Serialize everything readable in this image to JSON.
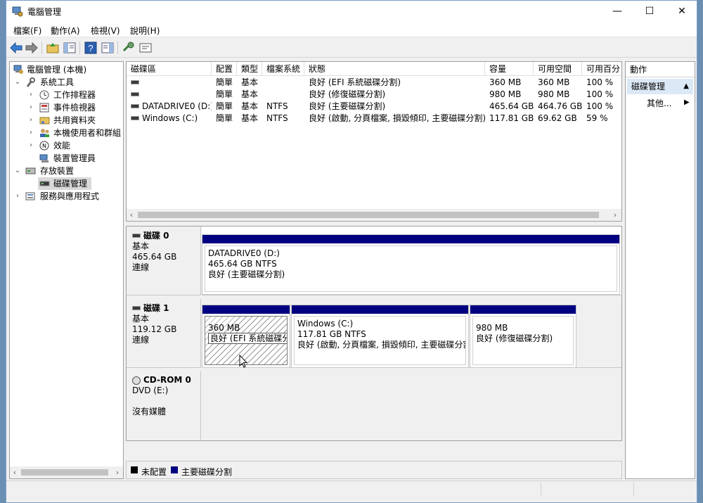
{
  "window": {
    "title": "電腦管理"
  },
  "menu": [
    "檔案(F)",
    "動作(A)",
    "檢視(V)",
    "說明(H)"
  ],
  "tree": {
    "root": "電腦管理 (本機)",
    "system_tools": "系統工具",
    "task_scheduler": "工作排程器",
    "event_viewer": "事件檢視器",
    "shared_folders": "共用資料夾",
    "local_users": "本機使用者和群組",
    "performance": "效能",
    "device_manager": "裝置管理員",
    "storage": "存放裝置",
    "disk_management": "磁碟管理",
    "services_apps": "服務與應用程式"
  },
  "volume_table": {
    "headers": [
      "磁碟區",
      "配置",
      "類型",
      "檔案系統",
      "狀態",
      "容量",
      "可用空間",
      "可用百分"
    ],
    "rows": [
      [
        "",
        "簡單",
        "基本",
        "",
        "良好 (EFI 系統磁碟分割)",
        "360 MB",
        "360 MB",
        "100 %"
      ],
      [
        "",
        "簡單",
        "基本",
        "",
        "良好 (修復磁碟分割)",
        "980 MB",
        "980 MB",
        "100 %"
      ],
      [
        "DATADRIVE0 (D:)",
        "簡單",
        "基本",
        "NTFS",
        "良好 (主要磁碟分割)",
        "465.64 GB",
        "464.76 GB",
        "100 %"
      ],
      [
        "Windows (C:)",
        "簡單",
        "基本",
        "NTFS",
        "良好 (啟動, 分頁檔案, 損毀傾印, 主要磁碟分割)",
        "117.81 GB",
        "69.62 GB",
        "59 %"
      ]
    ]
  },
  "disks": [
    {
      "name": "磁碟 0",
      "type": "基本",
      "size": "465.64 GB",
      "status": "連線",
      "partitions": [
        {
          "title": "DATADRIVE0  (D:)",
          "size": "465.64 GB NTFS",
          "status": "良好 (主要磁碟分割)"
        }
      ]
    },
    {
      "name": "磁碟 1",
      "type": "基本",
      "size": "119.12 GB",
      "status": "連線",
      "partitions": [
        {
          "title": "",
          "size": "360 MB",
          "status": "良好 (EFI 系統磁碟分割)"
        },
        {
          "title": "Windows  (C:)",
          "size": "117.81 GB NTFS",
          "status": "良好 (啟動, 分頁檔案, 損毀傾印, 主要磁碟分割"
        },
        {
          "title": "",
          "size": "980 MB",
          "status": "良好 (修復磁碟分割)"
        }
      ]
    },
    {
      "name": "CD-ROM 0",
      "type": "DVD (E:)",
      "size": "",
      "status": "沒有媒體"
    }
  ],
  "legend": {
    "unallocated": "未配置",
    "primary": "主要磁碟分割"
  },
  "actions": {
    "header": "動作",
    "group": "磁碟管理",
    "more": "其他..."
  },
  "colors": {
    "partition_bar": "#000080",
    "unallocated": "#000000"
  }
}
